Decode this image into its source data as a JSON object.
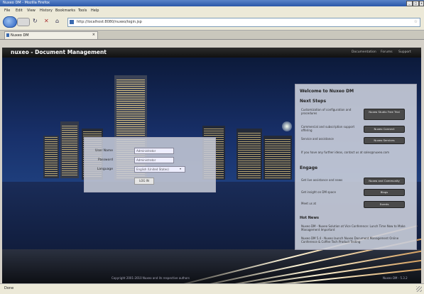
{
  "browser": {
    "window_title": "Nuxeo DM - Mozilla Firefox",
    "menu": [
      "File",
      "Edit",
      "View",
      "History",
      "Bookmarks",
      "Tools",
      "Help"
    ],
    "url": "http://localhost:8080/nuxeo/login.jsp",
    "tab_label": "Nuxeo DM"
  },
  "app": {
    "brand": "nuxeo - Document Management",
    "header_links": [
      "Documentation",
      "Forums",
      "Support"
    ]
  },
  "login": {
    "username_label": "User Name",
    "username_value": "Administrator",
    "password_label": "Password",
    "password_value": "Administrator",
    "language_label": "Language",
    "language_value": "English (United States)",
    "login_button": "LOG IN"
  },
  "welcome": {
    "title": "Welcome to Nuxeo DM",
    "next_steps_heading": "Next Steps",
    "steps": [
      {
        "text": "Customization of configuration and procedures",
        "button": "Nuxeo Studio Free Trial"
      },
      {
        "text": "Commercial and subscription support offering",
        "button": "Nuxeo Connect"
      },
      {
        "text": "Service and assistance",
        "button": "Nuxeo Services"
      }
    ],
    "contact_text": "If you have any further ideas, contact us at sales@nuxeo.com",
    "engage_heading": "Engage",
    "engage": [
      {
        "text": "Get live assistance and news",
        "button": "Nuxeo and Community"
      },
      {
        "text": "Get insight on DM space",
        "button": "Blogs"
      },
      {
        "text": "Meet us at",
        "button": "Events"
      }
    ],
    "news_heading": "Hot News",
    "news": [
      "Nuxeo DM - Nuxeo Solution at Vice Conference: Lunch Time Now to Make Management Important",
      "Nuxeo DM 5.4 - Nuxeo launch Nuxeo Document Management Online Conference & Coffee Tech Product Testing"
    ]
  },
  "footer": {
    "copyright": "Copyright 2001-2010 Nuxeo and its respective authors",
    "version": "Nuxeo DM - 5.3.2"
  },
  "status": {
    "text": "Done"
  }
}
